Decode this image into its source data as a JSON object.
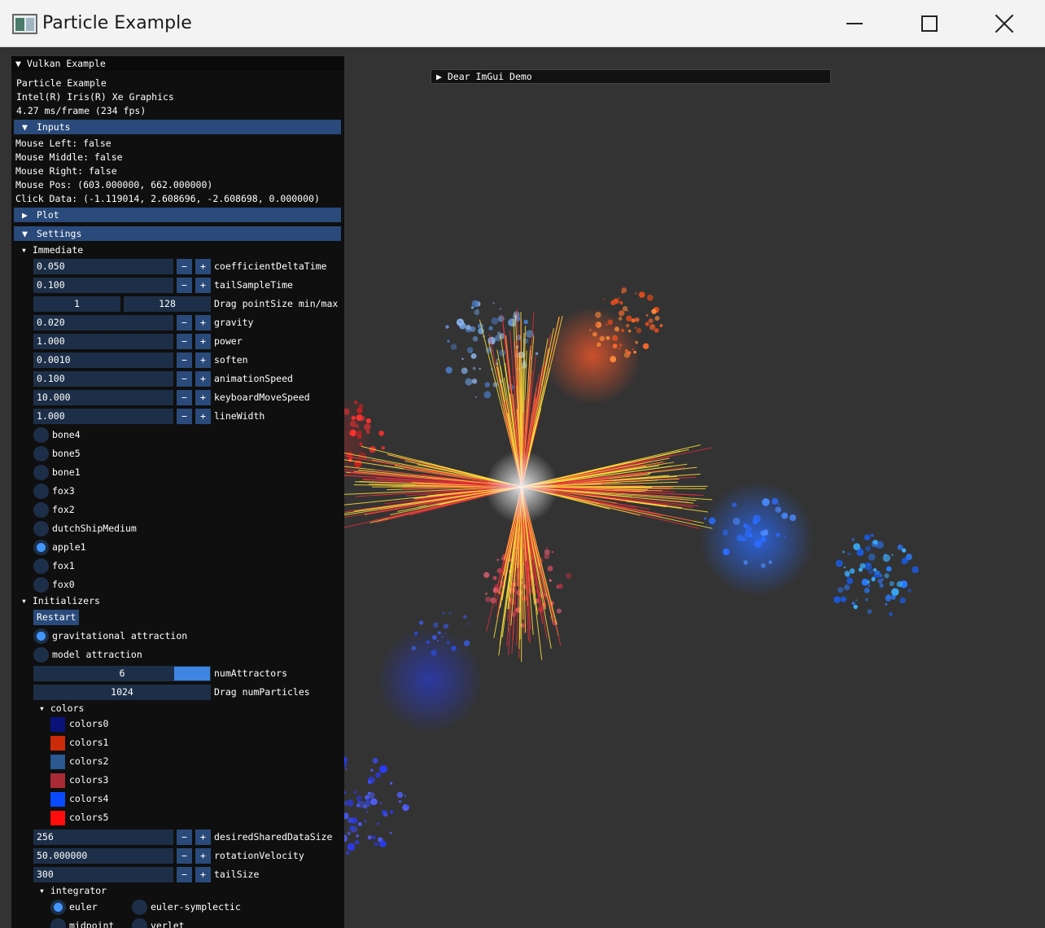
{
  "window": {
    "title": "Particle Example",
    "icon": "app-icon",
    "controls": [
      "minimize-icon",
      "maximize-icon",
      "close-icon"
    ]
  },
  "demo_window": {
    "label": "Dear ImGui Demo",
    "arrow": "▶"
  },
  "panel": {
    "title": "Vulkan Example",
    "title_arrow": "▼",
    "info": [
      "Particle Example",
      "Intel(R) Iris(R) Xe Graphics",
      "4.27 ms/frame (234 fps)"
    ],
    "inputs": {
      "header": "Inputs",
      "arrow": "▼",
      "lines": [
        "Mouse Left: false",
        "Mouse Middle: false",
        "Mouse Right: false",
        "Mouse Pos: (603.000000, 662.000000)",
        "Click Data: (-1.119014, 2.608696, -2.608698, 0.000000)"
      ]
    },
    "plot": {
      "header": "Plot",
      "arrow": "▶"
    },
    "settings": {
      "header": "Settings",
      "arrow": "▼",
      "immediate": {
        "label": "Immediate",
        "arrow": "▾",
        "params1": [
          {
            "value": "0.050",
            "label": "coefficientDeltaTime"
          },
          {
            "value": "0.100",
            "label": "tailSampleTime"
          }
        ],
        "pointsize": {
          "min": "1",
          "max": "128",
          "label": "Drag pointSize min/max"
        },
        "params2": [
          {
            "value": "0.020",
            "label": "gravity"
          },
          {
            "value": "1.000",
            "label": "power"
          },
          {
            "value": "0.0010",
            "label": "soften"
          },
          {
            "value": "0.100",
            "label": "animationSpeed"
          },
          {
            "value": "10.000",
            "label": "keyboardMoveSpeed"
          },
          {
            "value": "1.000",
            "label": "lineWidth"
          }
        ],
        "models": [
          {
            "label": "bone4",
            "selected": false
          },
          {
            "label": "bone5",
            "selected": false
          },
          {
            "label": "bone1",
            "selected": false
          },
          {
            "label": "fox3",
            "selected": false
          },
          {
            "label": "fox2",
            "selected": false
          },
          {
            "label": "dutchShipMedium",
            "selected": false
          },
          {
            "label": "apple1",
            "selected": true
          },
          {
            "label": "fox1",
            "selected": false
          },
          {
            "label": "fox0",
            "selected": false
          }
        ]
      },
      "initializers": {
        "label": "Initializers",
        "arrow": "▾",
        "restart": "Restart",
        "modes": [
          {
            "label": "gravitational attraction",
            "selected": true
          },
          {
            "label": "model attraction",
            "selected": false
          }
        ],
        "num_attractors": {
          "value": "6",
          "label": "numAttractors",
          "fraction": 0.2
        },
        "num_particles": {
          "value": "1024",
          "label": "Drag numParticles"
        },
        "colors": {
          "label": "colors",
          "arrow": "▾",
          "items": [
            {
              "label": "colors0",
              "hex": "#0a127a"
            },
            {
              "label": "colors1",
              "hex": "#cc2b0a"
            },
            {
              "label": "colors2",
              "hex": "#2a5890"
            },
            {
              "label": "colors3",
              "hex": "#a82a35"
            },
            {
              "label": "colors4",
              "hex": "#0a4aff"
            },
            {
              "label": "colors5",
              "hex": "#ff0d0d"
            }
          ]
        },
        "params": [
          {
            "value": "256",
            "label": "desiredSharedDataSize"
          },
          {
            "value": "50.000000",
            "label": "rotationVelocity"
          },
          {
            "value": "300",
            "label": "tailSize"
          }
        ],
        "integrator": {
          "label": "integrator",
          "arrow": "▾",
          "options": [
            {
              "label": "euler",
              "selected": true
            },
            {
              "label": "euler-symplectic",
              "selected": false
            },
            {
              "label": "midpoint",
              "selected": false
            },
            {
              "label": "verlet",
              "selected": false
            }
          ]
        }
      }
    },
    "step_minus": "−",
    "step_plus": "+"
  }
}
